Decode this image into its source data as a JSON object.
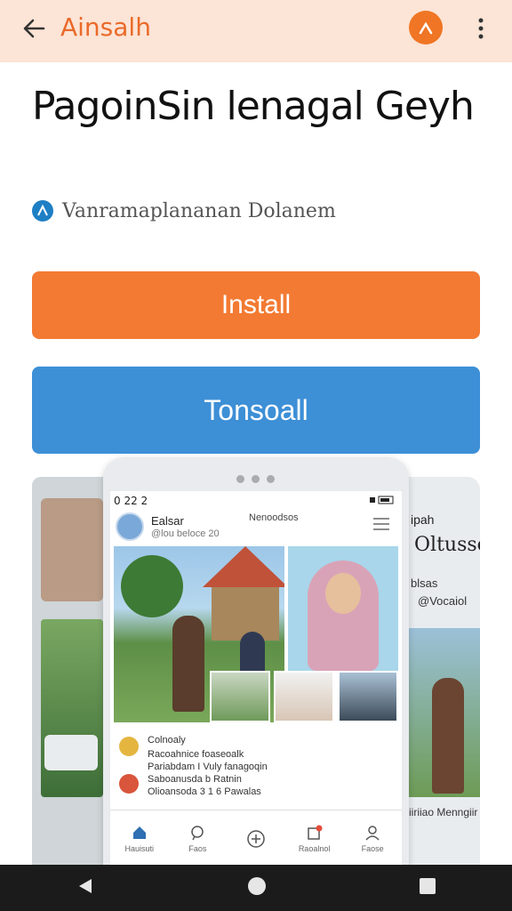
{
  "topbar": {
    "title": "Ainsalh",
    "back_icon": "arrow-left-icon",
    "app_icon": "close-x-icon",
    "more_icon": "more-vert-icon",
    "accent": "#f07524"
  },
  "app": {
    "title": "PagoinSin lenagal Geyh",
    "developer": "Vanramaplananan Dolanem"
  },
  "buttons": {
    "install_label": "Install",
    "second_label": "Tonsoall",
    "install_color": "#f37a32",
    "second_color": "#3d8fd6"
  },
  "screenshot": {
    "status_time": "0 22 2",
    "post_name": "Ealsar",
    "post_sub": "@lou beloce 20",
    "post_center": "Nenoodsos",
    "comments": [
      {
        "title": "Colnoaly",
        "text": ""
      },
      {
        "title": "",
        "text": "Racoahnice foaseoalk"
      },
      {
        "title": "",
        "text": "Pariabdam I Vuly fanagoqin"
      },
      {
        "title": "",
        "text": "Saboanusda b Ratnin"
      },
      {
        "title": "",
        "text": "Olioansoda 3 1 6 Pawalas"
      }
    ],
    "nav": [
      {
        "label": "Hauisuti",
        "icon": "home-icon"
      },
      {
        "label": "Faos",
        "icon": "chat-bubble-icon"
      },
      {
        "label": "",
        "icon": "add-circle-icon"
      },
      {
        "label": "Raoalnol",
        "icon": "notifications-icon"
      },
      {
        "label": "Faose",
        "icon": "profile-icon"
      }
    ]
  },
  "side_right": {
    "line1": "ipah",
    "line2": "Oltusse",
    "line3": "blsas",
    "line4": "@Vocaiol",
    "line5": "iiriiao Menngiir"
  },
  "system_nav": {
    "back": "triangle-back-icon",
    "home": "circle-home-icon",
    "recents": "square-recents-icon"
  }
}
